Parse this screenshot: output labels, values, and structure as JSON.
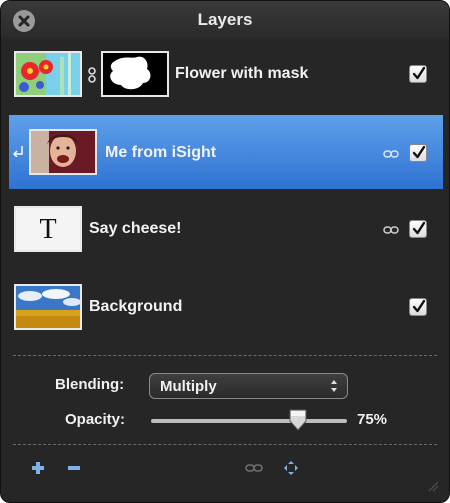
{
  "window": {
    "title": "Layers"
  },
  "layers": [
    {
      "name": "Flower with mask",
      "visible": true,
      "has_mask": true,
      "selected": false,
      "thumbnail": "flower-image"
    },
    {
      "name": "Me from iSight",
      "visible": true,
      "linked": true,
      "clipped": true,
      "selected": true,
      "thumbnail": "portrait-photo"
    },
    {
      "name": "Say cheese!",
      "visible": true,
      "linked": true,
      "selected": false,
      "thumbnail": "text-layer",
      "thumbnail_text": "T"
    },
    {
      "name": "Background",
      "visible": true,
      "selected": false,
      "thumbnail": "landscape-photo"
    }
  ],
  "blending": {
    "label": "Blending:",
    "value": "Multiply"
  },
  "opacity": {
    "label": "Opacity:",
    "display": "75%",
    "value": 0.75
  },
  "footer": {
    "add": "+",
    "remove": "−"
  },
  "colors": {
    "panel": "#262626",
    "selection": "#3f86e0",
    "text": "#f0f0f0"
  }
}
